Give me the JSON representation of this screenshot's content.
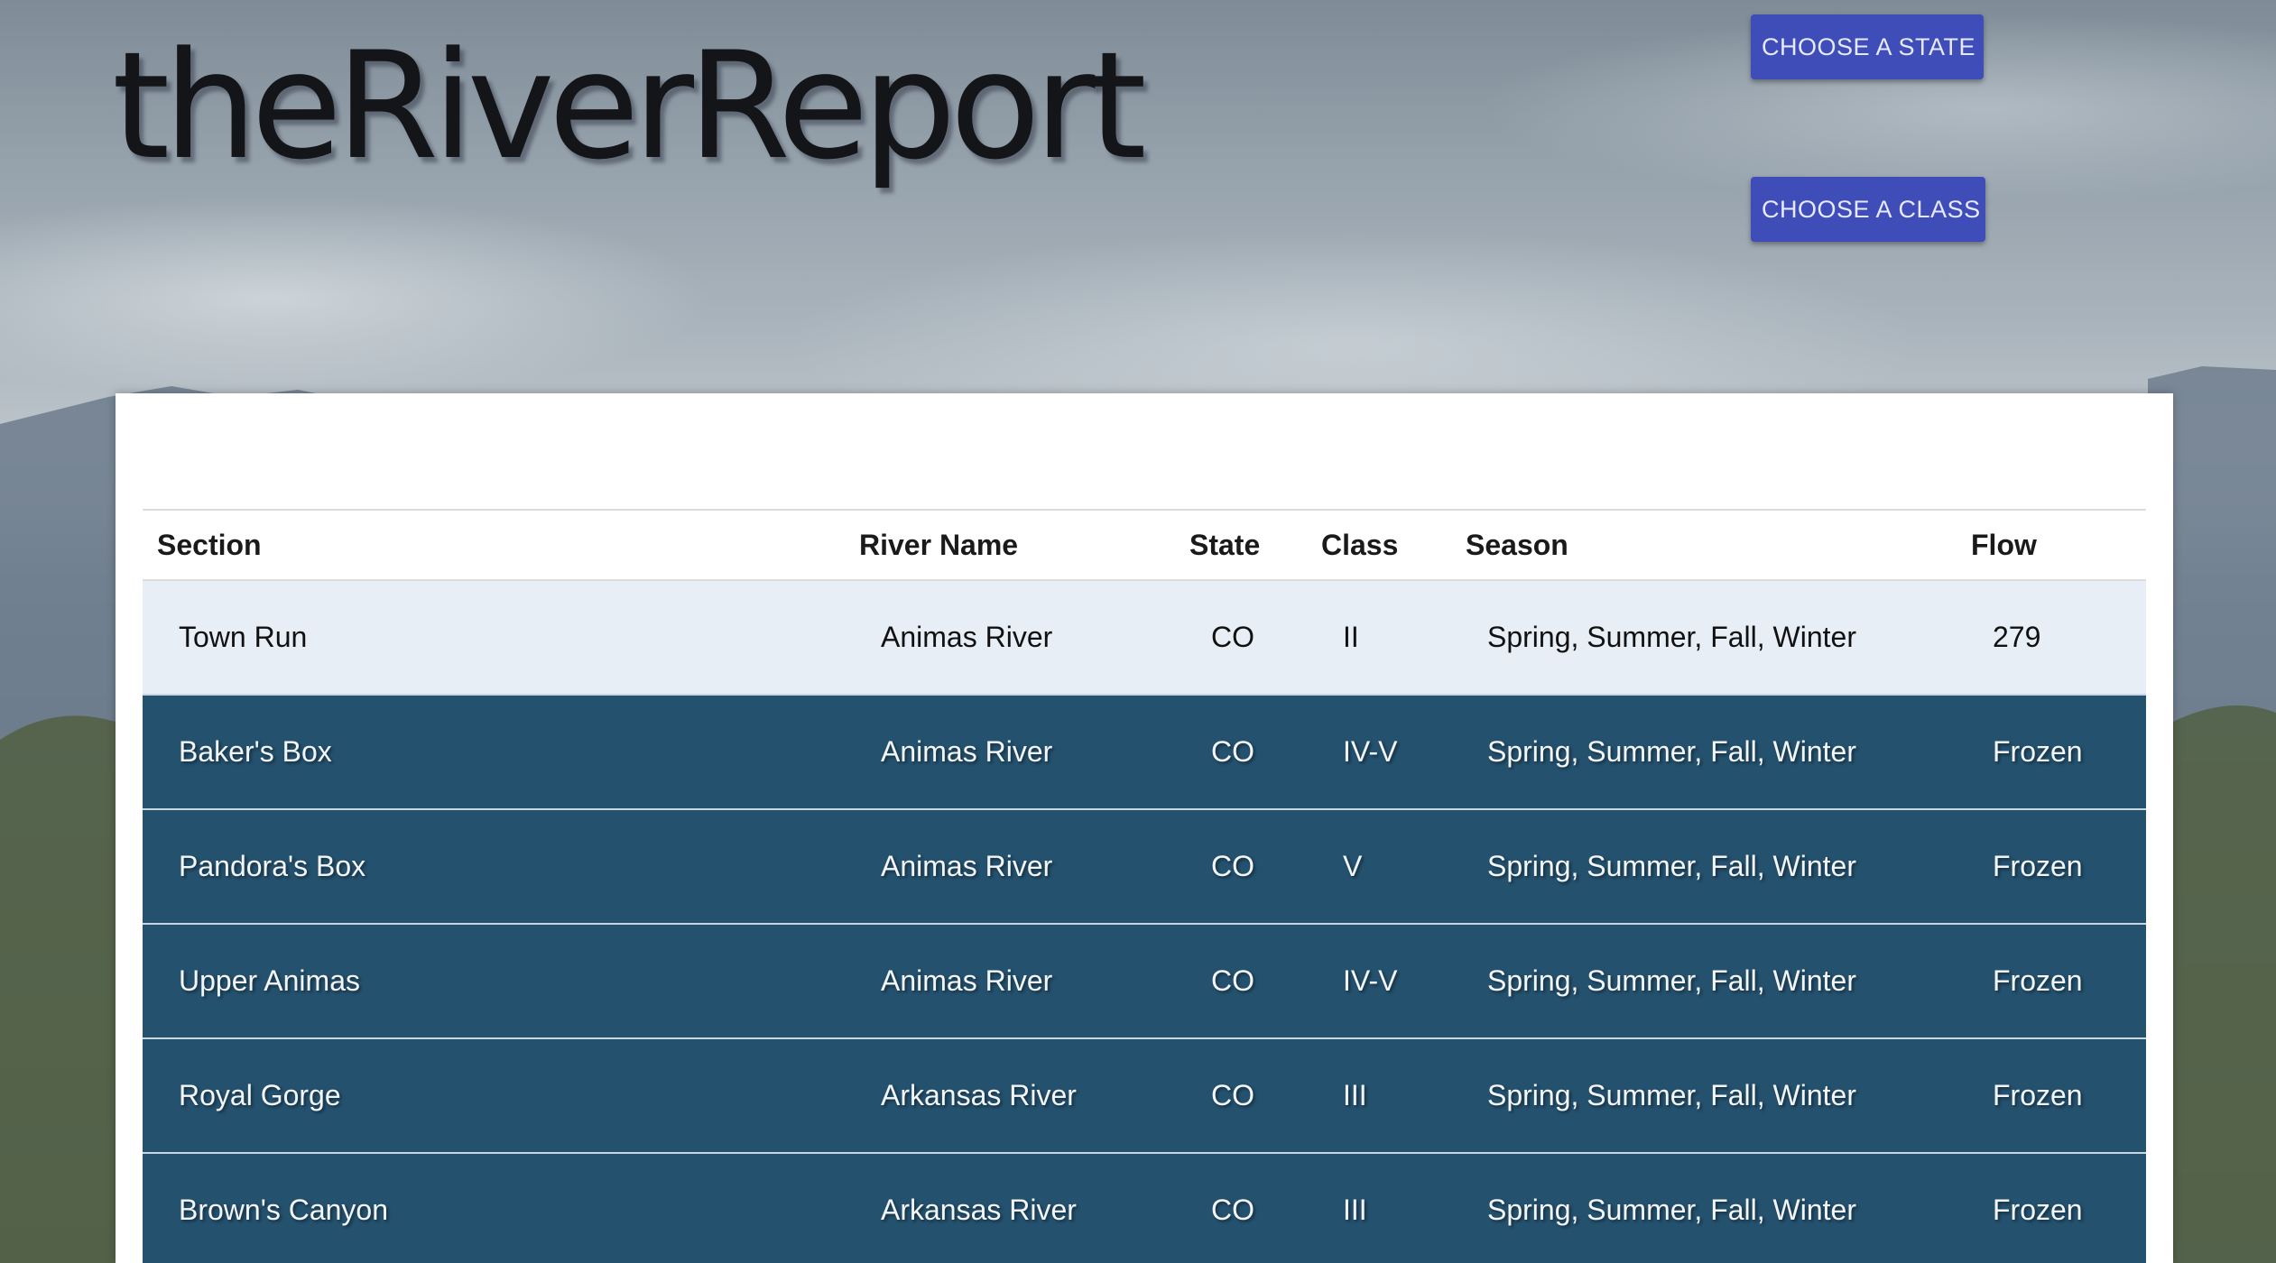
{
  "header": {
    "logo": "theRiverReport",
    "choose_state_label": "CHOOSE A STATE",
    "choose_class_label": "CHOOSE A CLASS"
  },
  "table": {
    "columns": [
      "Section",
      "River Name",
      "State",
      "Class",
      "Season",
      "Flow"
    ],
    "rows": [
      {
        "section": "Town Run",
        "river": "Animas River",
        "state": "CO",
        "class": "II",
        "season": "Spring, Summer, Fall, Winter",
        "flow": "279"
      },
      {
        "section": "Baker's Box",
        "river": "Animas River",
        "state": "CO",
        "class": "IV-V",
        "season": "Spring, Summer, Fall, Winter",
        "flow": "Frozen"
      },
      {
        "section": "Pandora's Box",
        "river": "Animas River",
        "state": "CO",
        "class": "V",
        "season": "Spring, Summer, Fall, Winter",
        "flow": "Frozen"
      },
      {
        "section": "Upper Animas",
        "river": "Animas River",
        "state": "CO",
        "class": "IV-V",
        "season": "Spring, Summer, Fall, Winter",
        "flow": "Frozen"
      },
      {
        "section": "Royal Gorge",
        "river": "Arkansas River",
        "state": "CO",
        "class": "III",
        "season": "Spring, Summer, Fall, Winter",
        "flow": "Frozen"
      },
      {
        "section": "Brown's Canyon",
        "river": "Arkansas River",
        "state": "CO",
        "class": "III",
        "season": "Spring, Summer, Fall, Winter",
        "flow": "Frozen"
      }
    ]
  },
  "colors": {
    "button": "#3f4db8",
    "row_highlight": "#e8eef6",
    "row_dark": "#24516e"
  }
}
